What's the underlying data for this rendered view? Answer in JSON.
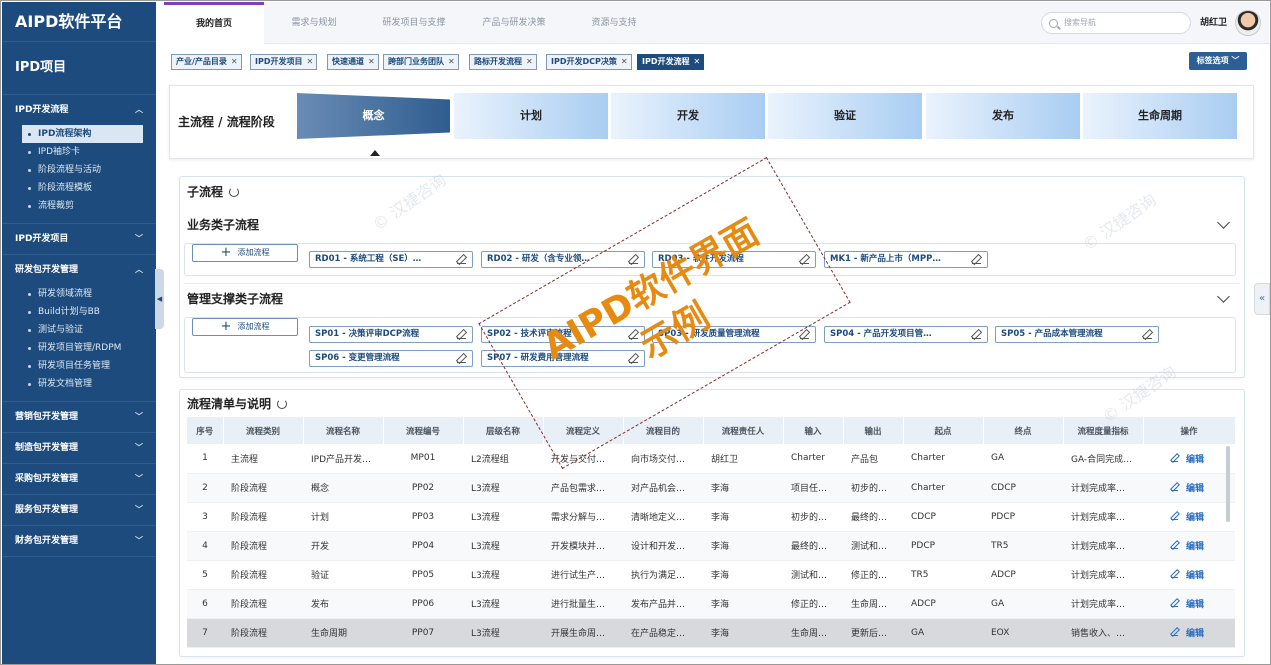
{
  "sidebar": {
    "brand": "AIPD软件平台",
    "project": "IPD项目",
    "groups": [
      {
        "label": "IPD开发流程",
        "items": [
          "IPD流程架构",
          "IPD袖珍卡",
          "阶段流程与活动",
          "阶段流程模板",
          "流程裁剪"
        ],
        "active": "IPD流程架构"
      },
      {
        "label": "IPD开发项目"
      },
      {
        "label": "研发包开发管理",
        "items": [
          "研发领域流程",
          "Build计划与BB",
          "测试与验证",
          "研发项目管理/RDPM",
          "研发项目任务管理",
          "研发文档管理"
        ]
      },
      {
        "label": "营销包开发管理"
      },
      {
        "label": "制造包开发管理"
      },
      {
        "label": "采购包开发管理"
      },
      {
        "label": "服务包开发管理"
      },
      {
        "label": "财务包开发管理"
      }
    ]
  },
  "topbar": {
    "tabs": [
      "我的首页",
      "需求与规划",
      "研发项目与支撑",
      "产品与研发决策",
      "资源与支持"
    ],
    "active_tab": "我的首页",
    "search_placeholder": "搜索导航",
    "user": "胡红卫"
  },
  "tagbar": {
    "tags": [
      "产业/产品目录",
      "IPD开发项目",
      "快速通道",
      "跨部门业务团队",
      "路标开发流程",
      "IPD开发DCP决策",
      "IPD开发流程"
    ],
    "active": "IPD开发流程",
    "options_label": "标签选项"
  },
  "stage": {
    "title": "主流程 / 流程阶段",
    "phases": [
      "概念",
      "计划",
      "开发",
      "验证",
      "发布",
      "生命周期"
    ],
    "active": "概念"
  },
  "subflow": {
    "title": "子流程",
    "business": {
      "title": "业务类子流程",
      "add_label": "添加流程",
      "chips": [
        "RD01 - 系统工程（SE）…",
        "RD02 - 研发（含专业领…",
        "RD03 - 软件开发流程",
        "MK1 - 新产品上市（MPP…"
      ]
    },
    "support": {
      "title": "管理支撑类子流程",
      "add_label": "添加流程",
      "chips": [
        "SP01 - 决策评审DCP流程",
        "SP02 - 技术评审流程",
        "SP03 - 研发质量管理流程",
        "SP04 - 产品开发项目管…",
        "SP05 - 产品成本管理流程",
        "SP06 - 变更管理流程",
        "SP07 - 研发费用管理流程"
      ]
    }
  },
  "list": {
    "title": "流程清单与说明",
    "columns": [
      "序号",
      "流程类别",
      "流程名称",
      "流程编号",
      "层级名称",
      "流程定义",
      "流程目的",
      "流程责任人",
      "输入",
      "输出",
      "起点",
      "终点",
      "流程度量指标",
      "操作"
    ],
    "edit_label": "编辑",
    "rows": [
      [
        "1",
        "主流程",
        "IPD产品开发…",
        "MP01",
        "L2流程组",
        "开发与交付…",
        "向市场交付…",
        "胡红卫",
        "Charter",
        "产品包",
        "Charter",
        "GA",
        "GA-合同完成…"
      ],
      [
        "2",
        "阶段流程",
        "概念",
        "PP02",
        "L3流程",
        "产品包需求…",
        "对产品机会…",
        "李海",
        "项目任…",
        "初步的…",
        "Charter",
        "CDCP",
        "计划完成率…"
      ],
      [
        "3",
        "阶段流程",
        "计划",
        "PP03",
        "L3流程",
        "需求分解与…",
        "清晰地定义…",
        "李海",
        "初步的…",
        "最终的…",
        "CDCP",
        "PDCP",
        "计划完成率…"
      ],
      [
        "4",
        "阶段流程",
        "开发",
        "PP04",
        "L3流程",
        "开发模块并…",
        "设计和开发…",
        "李海",
        "最终的…",
        "测试和…",
        "PDCP",
        "TR5",
        "计划完成率…"
      ],
      [
        "5",
        "阶段流程",
        "验证",
        "PP05",
        "L3流程",
        "进行试生产…",
        "执行为满足…",
        "李海",
        "测试和…",
        "修正的…",
        "TR5",
        "ADCP",
        "计划完成率…"
      ],
      [
        "6",
        "阶段流程",
        "发布",
        "PP06",
        "L3流程",
        "进行批量生…",
        "发布产品并…",
        "李海",
        "修正的…",
        "生命周…",
        "ADCP",
        "GA",
        "计划完成率…"
      ],
      [
        "7",
        "阶段流程",
        "生命周期",
        "PP07",
        "L3流程",
        "开展生命周…",
        "在产品稳定…",
        "李海",
        "生命周…",
        "更新后…",
        "GA",
        "EOX",
        "销售收入、…"
      ]
    ],
    "selected_row": 7
  },
  "watermark": {
    "text_line1": "AIPD软件界面",
    "text_line2": "示例",
    "faint": "© 汉捷咨询"
  },
  "colors": {
    "sidebar_bg": "#1d4b7d",
    "accent": "#7b3fbf",
    "watermark": "#e68a12",
    "link": "#2c6fbf"
  }
}
